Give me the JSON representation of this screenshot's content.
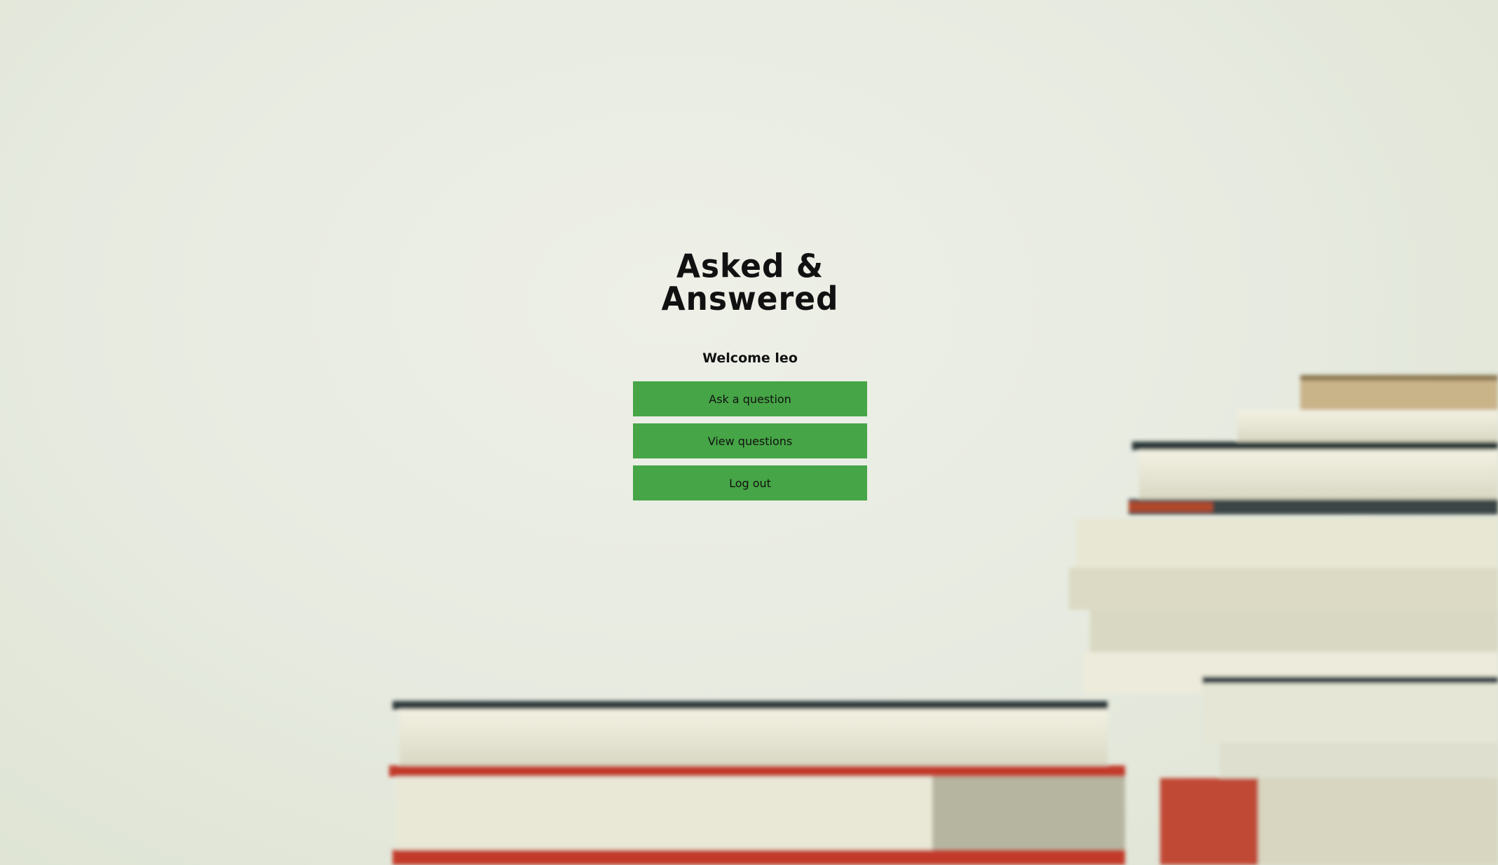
{
  "logo": {
    "line1": "Asked &",
    "line2": "Answered"
  },
  "welcome_text": "Welcome leo",
  "menu": {
    "ask_label": "Ask a question",
    "view_label": "View questions",
    "logout_label": "Log out"
  },
  "colors": {
    "button_bg": "#46a546",
    "text": "#111111",
    "background": "#e8ece0"
  }
}
